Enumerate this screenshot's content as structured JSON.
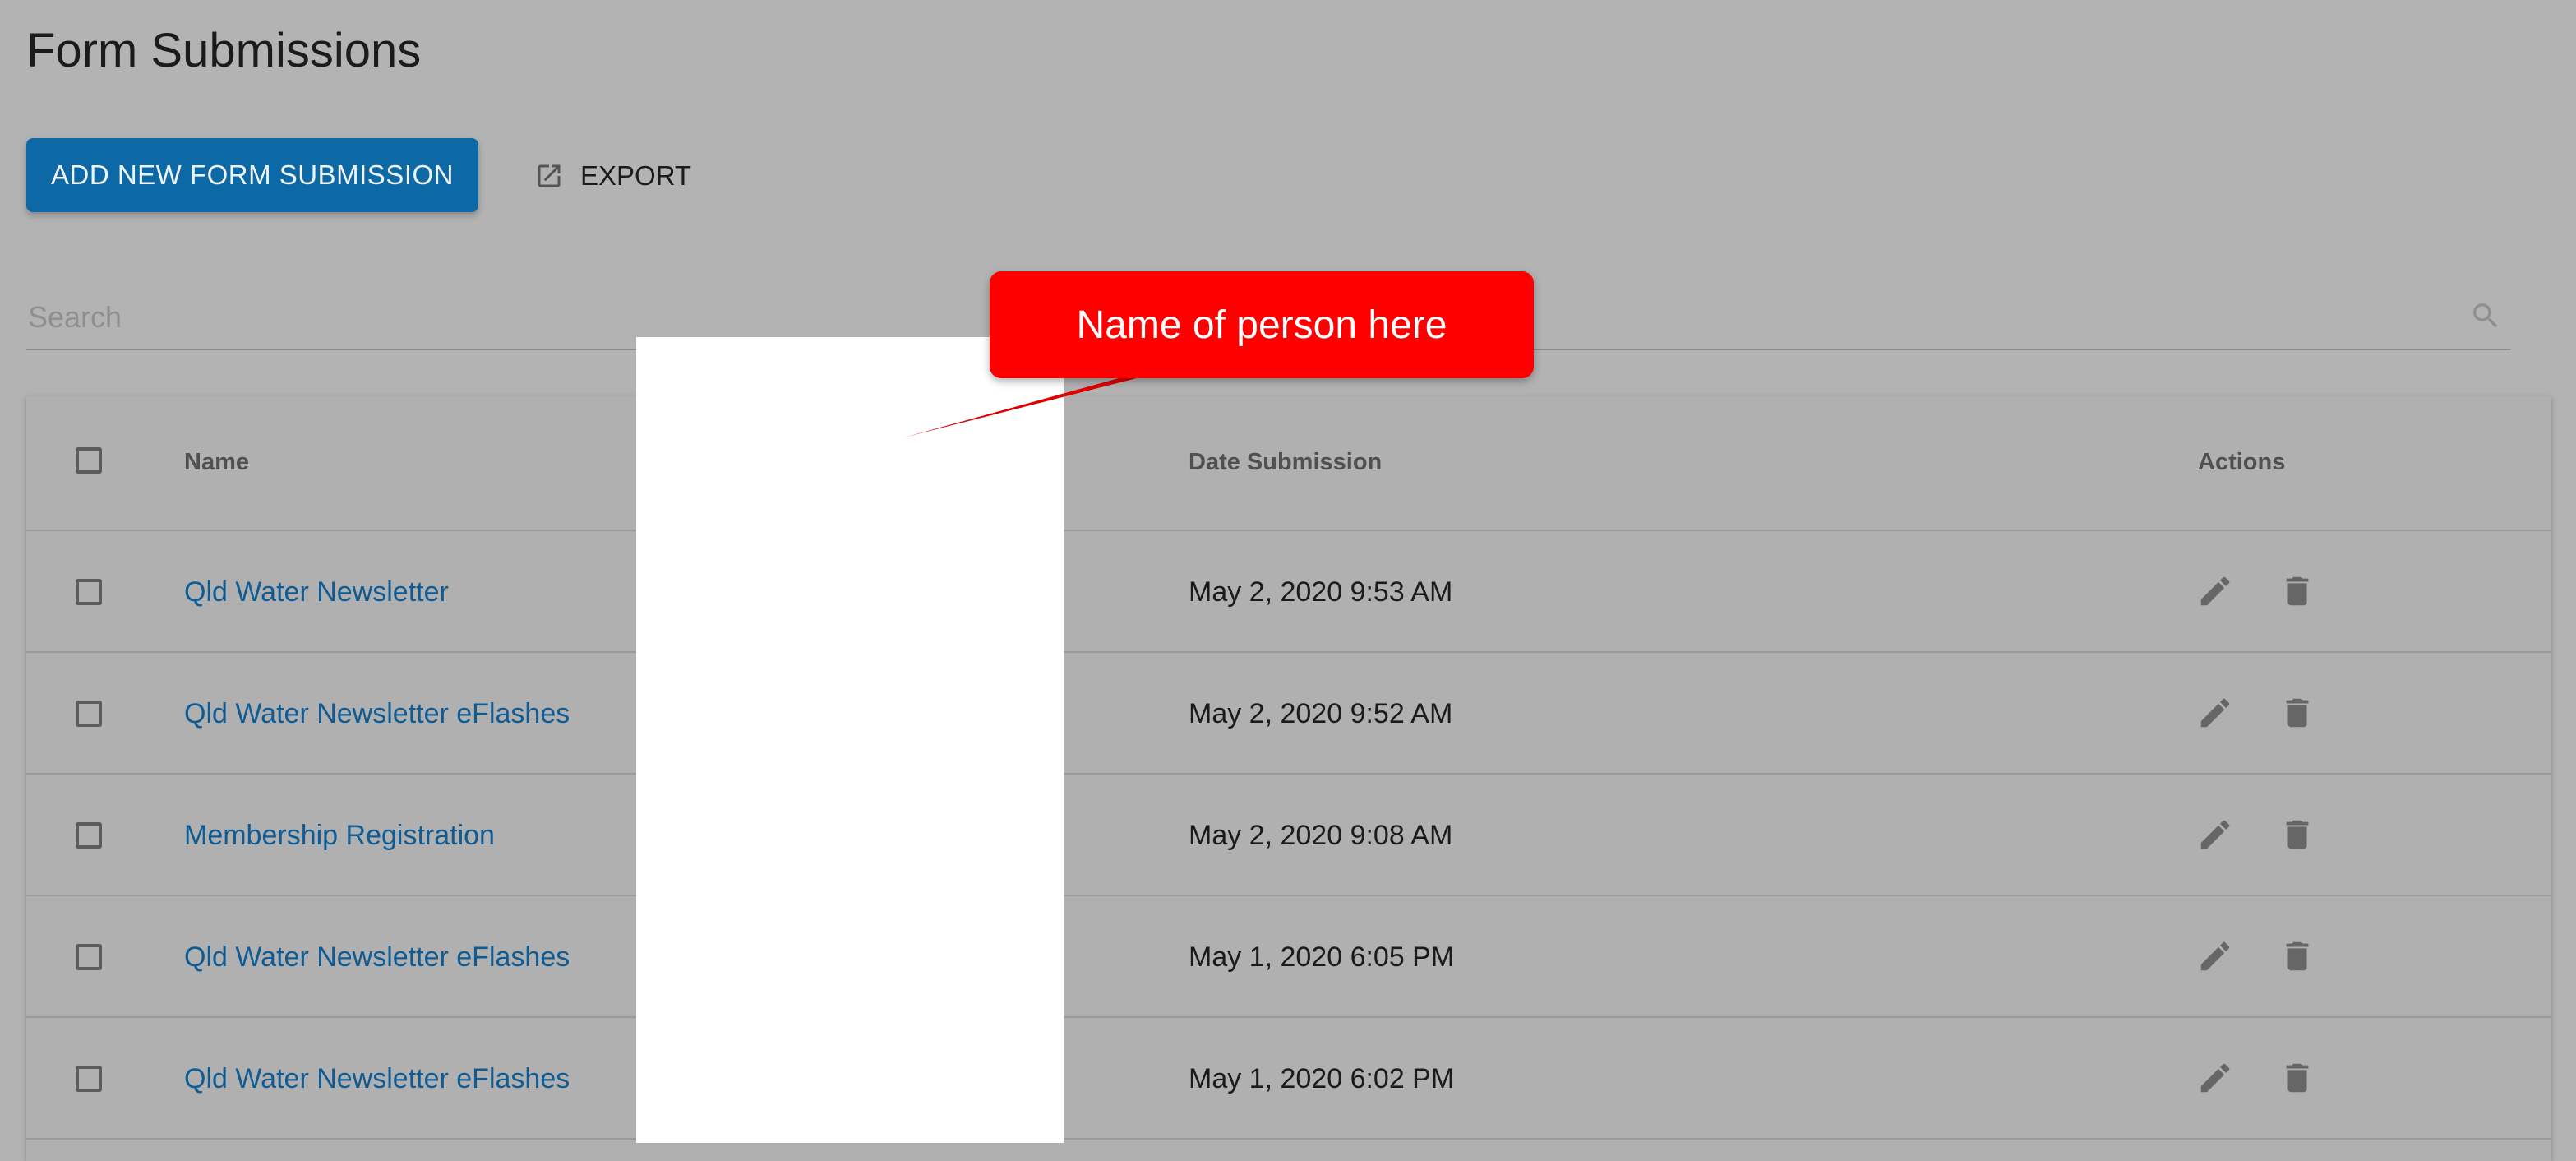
{
  "page": {
    "title": "Form Submissions"
  },
  "toolbar": {
    "add_label": "ADD NEW FORM SUBMISSION",
    "export_label": "EXPORT",
    "export_icon": "open-in-new-icon"
  },
  "search": {
    "placeholder": "Search",
    "value": "",
    "icon": "search-icon"
  },
  "table": {
    "columns": {
      "name": "Name",
      "date": "Date Submission",
      "actions": "Actions"
    },
    "rows": [
      {
        "name": "Qld Water Newsletter",
        "date": "May 2, 2020 9:53 AM"
      },
      {
        "name": "Qld Water Newsletter eFlashes",
        "date": "May 2, 2020 9:52 AM"
      },
      {
        "name": "Membership Registration",
        "date": "May 2, 2020 9:08 AM"
      },
      {
        "name": "Qld Water Newsletter eFlashes",
        "date": "May 1, 2020 6:05 PM"
      },
      {
        "name": "Qld Water Newsletter eFlashes",
        "date": "May 1, 2020 6:02 PM"
      }
    ],
    "row_action_icons": [
      "pencil-icon",
      "trash-icon"
    ]
  },
  "annotation": {
    "callout_text": "Name of person here"
  },
  "colors": {
    "primary": "#0d69a6",
    "link": "#0f5c95",
    "overlay_background": "#b3b3b3",
    "callout": "#ff0000"
  }
}
